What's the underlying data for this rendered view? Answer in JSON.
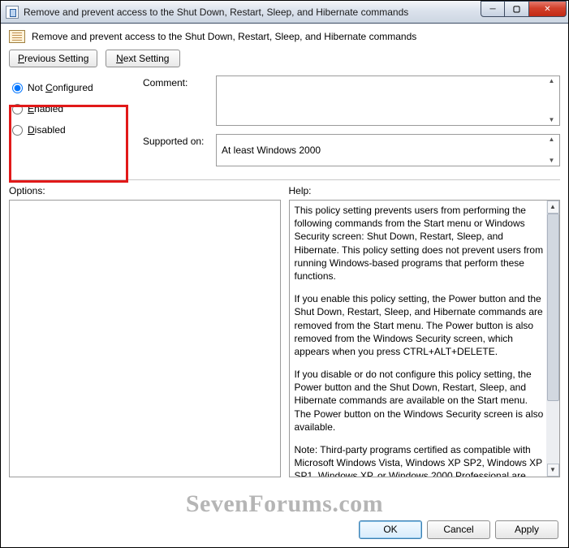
{
  "window": {
    "title": "Remove and prevent access to the Shut Down, Restart, Sleep, and Hibernate commands"
  },
  "heading": "Remove and prevent access to the Shut Down, Restart, Sleep, and Hibernate commands",
  "nav": {
    "previous": "Previous Setting",
    "next": "Next Setting",
    "previous_ul": "P",
    "next_ul": "N"
  },
  "radios": {
    "not_configured": "Not Configured",
    "enabled": "Enabled",
    "disabled": "Disabled",
    "selected": "not_configured",
    "nc_ul": "C",
    "en_ul": "E",
    "di_ul": "D"
  },
  "labels": {
    "comment": "Comment:",
    "supported": "Supported on:",
    "options": "Options:",
    "help": "Help:"
  },
  "fields": {
    "comment_value": "",
    "supported_value": "At least Windows 2000"
  },
  "help": {
    "p1": "This policy setting prevents users from performing the following commands from the Start menu or Windows Security screen: Shut Down, Restart, Sleep, and Hibernate. This policy setting does not prevent users from running Windows-based programs that perform these functions.",
    "p2": "If you enable this policy setting, the Power button and the Shut Down, Restart, Sleep, and Hibernate commands are removed from the Start menu. The Power button is also removed from the Windows Security screen, which appears when you press CTRL+ALT+DELETE.",
    "p3": "If you disable or do not configure this policy setting, the Power button and the Shut Down, Restart, Sleep, and Hibernate commands are available on the Start menu. The Power button on the Windows Security screen is also available.",
    "p4": "Note: Third-party programs certified as compatible with Microsoft Windows Vista, Windows XP SP2, Windows XP SP1, Windows XP, or Windows 2000 Professional are required to support this policy setting."
  },
  "buttons": {
    "ok": "OK",
    "cancel": "Cancel",
    "apply": "Apply"
  },
  "watermark": "SevenForums.com"
}
